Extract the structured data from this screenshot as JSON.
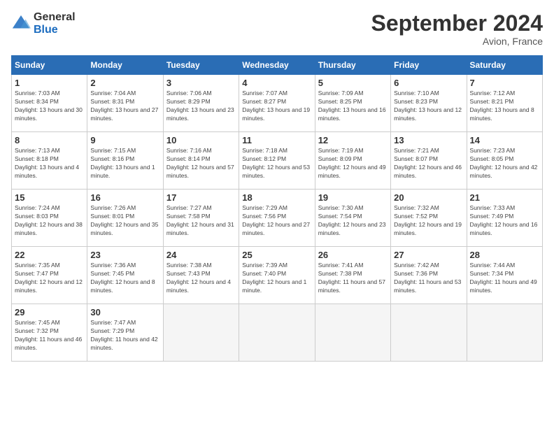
{
  "header": {
    "logo_general": "General",
    "logo_blue": "Blue",
    "month_title": "September 2024",
    "location": "Avion, France"
  },
  "weekdays": [
    "Sunday",
    "Monday",
    "Tuesday",
    "Wednesday",
    "Thursday",
    "Friday",
    "Saturday"
  ],
  "weeks": [
    [
      {
        "day": "1",
        "sunrise": "Sunrise: 7:03 AM",
        "sunset": "Sunset: 8:34 PM",
        "daylight": "Daylight: 13 hours and 30 minutes."
      },
      {
        "day": "2",
        "sunrise": "Sunrise: 7:04 AM",
        "sunset": "Sunset: 8:31 PM",
        "daylight": "Daylight: 13 hours and 27 minutes."
      },
      {
        "day": "3",
        "sunrise": "Sunrise: 7:06 AM",
        "sunset": "Sunset: 8:29 PM",
        "daylight": "Daylight: 13 hours and 23 minutes."
      },
      {
        "day": "4",
        "sunrise": "Sunrise: 7:07 AM",
        "sunset": "Sunset: 8:27 PM",
        "daylight": "Daylight: 13 hours and 19 minutes."
      },
      {
        "day": "5",
        "sunrise": "Sunrise: 7:09 AM",
        "sunset": "Sunset: 8:25 PM",
        "daylight": "Daylight: 13 hours and 16 minutes."
      },
      {
        "day": "6",
        "sunrise": "Sunrise: 7:10 AM",
        "sunset": "Sunset: 8:23 PM",
        "daylight": "Daylight: 13 hours and 12 minutes."
      },
      {
        "day": "7",
        "sunrise": "Sunrise: 7:12 AM",
        "sunset": "Sunset: 8:21 PM",
        "daylight": "Daylight: 13 hours and 8 minutes."
      }
    ],
    [
      {
        "day": "8",
        "sunrise": "Sunrise: 7:13 AM",
        "sunset": "Sunset: 8:18 PM",
        "daylight": "Daylight: 13 hours and 4 minutes."
      },
      {
        "day": "9",
        "sunrise": "Sunrise: 7:15 AM",
        "sunset": "Sunset: 8:16 PM",
        "daylight": "Daylight: 13 hours and 1 minute."
      },
      {
        "day": "10",
        "sunrise": "Sunrise: 7:16 AM",
        "sunset": "Sunset: 8:14 PM",
        "daylight": "Daylight: 12 hours and 57 minutes."
      },
      {
        "day": "11",
        "sunrise": "Sunrise: 7:18 AM",
        "sunset": "Sunset: 8:12 PM",
        "daylight": "Daylight: 12 hours and 53 minutes."
      },
      {
        "day": "12",
        "sunrise": "Sunrise: 7:19 AM",
        "sunset": "Sunset: 8:09 PM",
        "daylight": "Daylight: 12 hours and 49 minutes."
      },
      {
        "day": "13",
        "sunrise": "Sunrise: 7:21 AM",
        "sunset": "Sunset: 8:07 PM",
        "daylight": "Daylight: 12 hours and 46 minutes."
      },
      {
        "day": "14",
        "sunrise": "Sunrise: 7:23 AM",
        "sunset": "Sunset: 8:05 PM",
        "daylight": "Daylight: 12 hours and 42 minutes."
      }
    ],
    [
      {
        "day": "15",
        "sunrise": "Sunrise: 7:24 AM",
        "sunset": "Sunset: 8:03 PM",
        "daylight": "Daylight: 12 hours and 38 minutes."
      },
      {
        "day": "16",
        "sunrise": "Sunrise: 7:26 AM",
        "sunset": "Sunset: 8:01 PM",
        "daylight": "Daylight: 12 hours and 35 minutes."
      },
      {
        "day": "17",
        "sunrise": "Sunrise: 7:27 AM",
        "sunset": "Sunset: 7:58 PM",
        "daylight": "Daylight: 12 hours and 31 minutes."
      },
      {
        "day": "18",
        "sunrise": "Sunrise: 7:29 AM",
        "sunset": "Sunset: 7:56 PM",
        "daylight": "Daylight: 12 hours and 27 minutes."
      },
      {
        "day": "19",
        "sunrise": "Sunrise: 7:30 AM",
        "sunset": "Sunset: 7:54 PM",
        "daylight": "Daylight: 12 hours and 23 minutes."
      },
      {
        "day": "20",
        "sunrise": "Sunrise: 7:32 AM",
        "sunset": "Sunset: 7:52 PM",
        "daylight": "Daylight: 12 hours and 19 minutes."
      },
      {
        "day": "21",
        "sunrise": "Sunrise: 7:33 AM",
        "sunset": "Sunset: 7:49 PM",
        "daylight": "Daylight: 12 hours and 16 minutes."
      }
    ],
    [
      {
        "day": "22",
        "sunrise": "Sunrise: 7:35 AM",
        "sunset": "Sunset: 7:47 PM",
        "daylight": "Daylight: 12 hours and 12 minutes."
      },
      {
        "day": "23",
        "sunrise": "Sunrise: 7:36 AM",
        "sunset": "Sunset: 7:45 PM",
        "daylight": "Daylight: 12 hours and 8 minutes."
      },
      {
        "day": "24",
        "sunrise": "Sunrise: 7:38 AM",
        "sunset": "Sunset: 7:43 PM",
        "daylight": "Daylight: 12 hours and 4 minutes."
      },
      {
        "day": "25",
        "sunrise": "Sunrise: 7:39 AM",
        "sunset": "Sunset: 7:40 PM",
        "daylight": "Daylight: 12 hours and 1 minute."
      },
      {
        "day": "26",
        "sunrise": "Sunrise: 7:41 AM",
        "sunset": "Sunset: 7:38 PM",
        "daylight": "Daylight: 11 hours and 57 minutes."
      },
      {
        "day": "27",
        "sunrise": "Sunrise: 7:42 AM",
        "sunset": "Sunset: 7:36 PM",
        "daylight": "Daylight: 11 hours and 53 minutes."
      },
      {
        "day": "28",
        "sunrise": "Sunrise: 7:44 AM",
        "sunset": "Sunset: 7:34 PM",
        "daylight": "Daylight: 11 hours and 49 minutes."
      }
    ],
    [
      {
        "day": "29",
        "sunrise": "Sunrise: 7:45 AM",
        "sunset": "Sunset: 7:32 PM",
        "daylight": "Daylight: 11 hours and 46 minutes."
      },
      {
        "day": "30",
        "sunrise": "Sunrise: 7:47 AM",
        "sunset": "Sunset: 7:29 PM",
        "daylight": "Daylight: 11 hours and 42 minutes."
      },
      null,
      null,
      null,
      null,
      null
    ]
  ]
}
